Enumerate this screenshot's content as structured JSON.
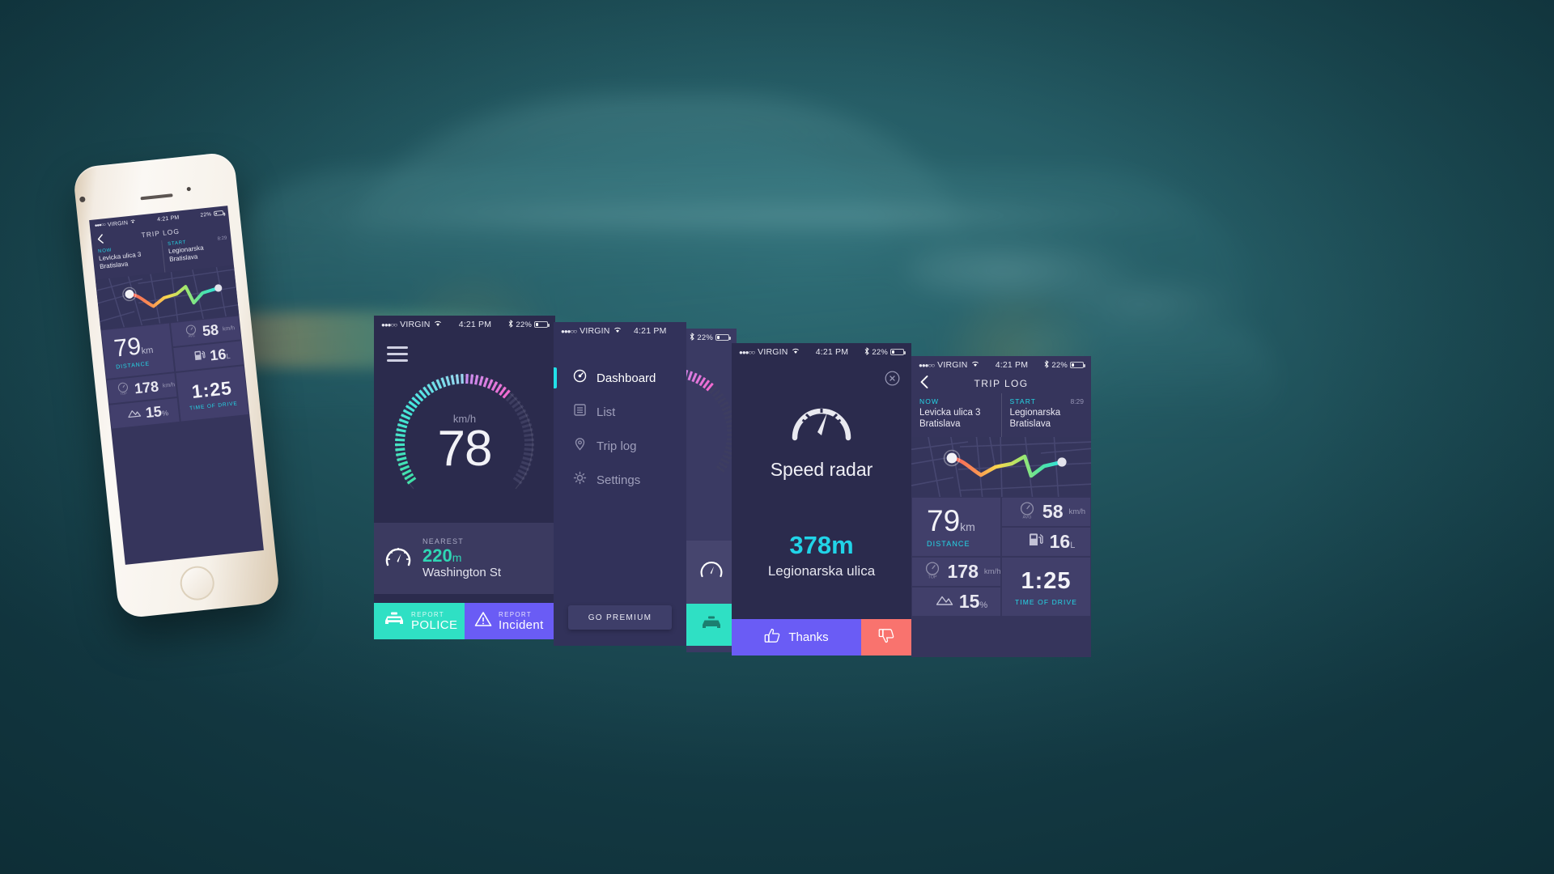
{
  "meta": {
    "scene": "mobile-app-showcase",
    "background_color": "#245a63",
    "accent_teal": "#2fe0c4",
    "accent_cyan": "#24d7e6",
    "accent_purple": "#6a5cf5",
    "accent_red": "#f9736e",
    "screen_bg": "#2b2b4d"
  },
  "statusbar": {
    "carrier_dots": "●●●○○",
    "carrier": "VIRGIN",
    "wifi_icon": "wifi-icon",
    "time": "4:21 PM",
    "bluetooth_icon": "bluetooth-icon",
    "battery_percent": "22%"
  },
  "dashboard": {
    "menu_icon": "hamburger-icon",
    "gauge": {
      "unit_label": "km/h",
      "speed": "78",
      "max": 180,
      "ticks_total": 60,
      "ticks_filled": 40
    },
    "nearest": {
      "gauge_icon": "speedometer-icon",
      "label": "NEAREST",
      "distance": "220",
      "distance_unit": "m",
      "street": "Washington St"
    },
    "report_police": {
      "icon": "police-car-icon",
      "small": "REPORT",
      "big": "POLICE"
    },
    "report_incident": {
      "icon": "warning-triangle-icon",
      "small": "REPORT",
      "big": "Incident"
    }
  },
  "menu": {
    "items": [
      {
        "label": "Dashboard",
        "icon": "dashboard-gauge-icon",
        "active": true
      },
      {
        "label": "List",
        "icon": "list-icon",
        "active": false
      },
      {
        "label": "Trip log",
        "icon": "location-pin-icon",
        "active": false
      },
      {
        "label": "Settings",
        "icon": "gear-icon",
        "active": false
      }
    ],
    "premium_button": "GO PREMIUM"
  },
  "radar": {
    "close_icon": "close-circle-icon",
    "gauge_icon": "speedometer-large-icon",
    "title": "Speed radar",
    "distance": "378m",
    "street": "Legionarska ulica",
    "thanks_button": {
      "icon": "thumbs-up-icon",
      "label": "Thanks"
    },
    "dislike_button": {
      "icon": "thumbs-down-icon",
      "label": ""
    }
  },
  "triplog": {
    "back_icon": "chevron-left-icon",
    "title": "TRIP LOG",
    "now": {
      "tag": "NOW",
      "address_line1": "Levicka ulica 3",
      "address_line2": "Bratislava"
    },
    "start": {
      "tag": "START",
      "time": "8:29",
      "address_line1": "Legionarska",
      "address_line2": "Bratislava"
    },
    "map": {
      "route_colors": [
        "#f5615c",
        "#fb8f52",
        "#f7d94f",
        "#a8e66a",
        "#4fe3a6",
        "#2fe0e0"
      ],
      "start_marker": "route-start-marker",
      "end_marker": "route-end-marker"
    },
    "stats": {
      "distance": {
        "value": "79",
        "unit": "km",
        "caption": "DISTANCE"
      },
      "avg_speed": {
        "icon": "avg-gauge-icon",
        "icon_label": "AVG",
        "value": "58",
        "unit": "km/h"
      },
      "fuel": {
        "icon": "fuel-pump-icon",
        "value": "16",
        "unit": "L"
      },
      "top_speed": {
        "icon": "top-gauge-icon",
        "icon_label": "TOP",
        "value": "178",
        "unit": "km/h"
      },
      "elevation": {
        "icon": "mountain-icon",
        "value": "15",
        "unit": "%"
      },
      "time_of_drive": {
        "value": "1:25",
        "caption": "TIME OF DRIVE"
      }
    }
  }
}
